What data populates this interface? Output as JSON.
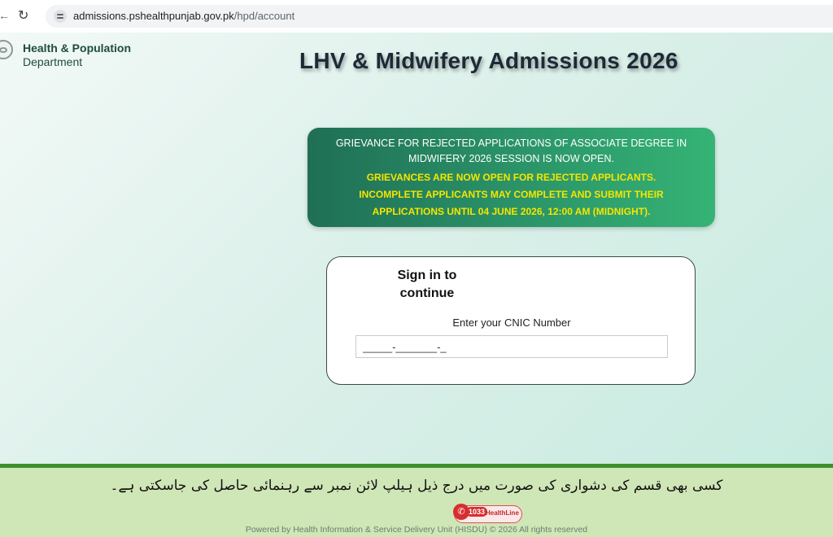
{
  "browser": {
    "url_host": "admissions.pshealthpunjab.gov.pk",
    "url_path": "/hpd/account"
  },
  "header": {
    "dept_name": "Health & Population",
    "dept_sub": "Department",
    "title": "LHV & Midwifery Admissions 2026"
  },
  "notice": {
    "line1": "GRIEVANCE FOR REJECTED APPLICATIONS OF ASSOCIATE DEGREE IN",
    "line2": "MIDWIFERY 2026 SESSION IS NOW OPEN.",
    "hl1": "GRIEVANCES ARE NOW OPEN FOR REJECTED APPLICANTS.",
    "hl2": "INCOMPLETE APPLICANTS MAY COMPLETE AND SUBMIT THEIR",
    "hl3": "APPLICATIONS UNTIL 04 JUNE 2026, 12:00 AM (MIDNIGHT)."
  },
  "signin": {
    "title": "Sign in to continue",
    "cnic_label": "Enter your CNIC Number",
    "cnic_value": "_____-_______-_"
  },
  "footer": {
    "urdu_text": "کسی بھی قسم کی دشواری کی صورت میں درج ذیل ہیلپ لائن نمبر سے رہنمائی حاصل کی جاسکتی ہے۔",
    "helpline_number": "1033",
    "helpline_name": "HealthLine",
    "powered_by": "Powered by Health Information & Service Delivery Unit (HISDU) © 2026 All rights reserved"
  },
  "colors": {
    "notice_start": "#1f6f55",
    "notice_end": "#35b375",
    "notice_highlight": "#f5e600",
    "footer_bg": "#cfe6b6",
    "footer_border": "#3f8f2e"
  }
}
